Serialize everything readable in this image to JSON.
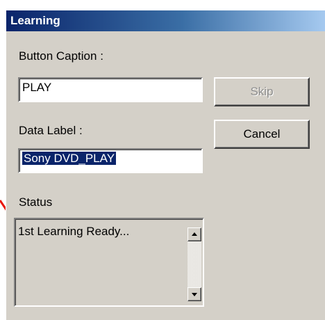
{
  "window": {
    "title": "Learning"
  },
  "form": {
    "button_caption_label": "Button Caption :",
    "button_caption_value": "PLAY",
    "data_label_label": "Data Label :",
    "data_label_value": "Sony DVD_PLAY",
    "status_label": "Status",
    "status_text": "1st Learning Ready..."
  },
  "buttons": {
    "skip": "Skip",
    "cancel": "Cancel"
  },
  "colors": {
    "selection": "#0a246a",
    "dialog_bg": "#d4d0c8",
    "annotation_arrow": "#e8160c"
  }
}
